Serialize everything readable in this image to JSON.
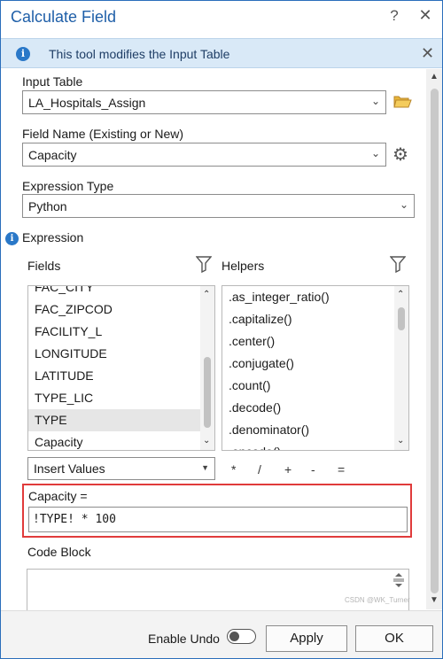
{
  "titlebar": {
    "title": "Calculate Field",
    "help": "?",
    "close": "✕"
  },
  "banner": {
    "icon": "i",
    "text": "This tool modifies the Input Table",
    "close": "✕"
  },
  "input_table": {
    "label": "Input Table",
    "value": "LA_Hospitals_Assign"
  },
  "field_name": {
    "label": "Field Name (Existing or New)",
    "value": "Capacity"
  },
  "expression_type": {
    "label": "Expression Type",
    "value": "Python"
  },
  "expression": {
    "label": "Expression",
    "icon": "i"
  },
  "fields": {
    "label": "Fields",
    "items": [
      "FAC_CITY",
      "FAC_ZIPCOD",
      "FACILITY_L",
      "LONGITUDE",
      "LATITUDE",
      "TYPE_LIC",
      "TYPE",
      "Capacity"
    ],
    "selected_index": 6
  },
  "helpers": {
    "label": "Helpers",
    "items": [
      ".as_integer_ratio()",
      ".capitalize()",
      ".center()",
      ".conjugate()",
      ".count()",
      ".decode()",
      ".denominator()",
      ".encode()"
    ]
  },
  "insert_values": {
    "label": "Insert Values"
  },
  "operators": [
    "*",
    "/",
    "+",
    "-",
    "="
  ],
  "expression_box": {
    "label": "Capacity =",
    "value": "!TYPE! * 100"
  },
  "code_block": {
    "label": "Code Block"
  },
  "footer": {
    "undo_label": "Enable Undo",
    "apply": "Apply",
    "ok": "OK"
  },
  "watermark": "CSDN @WK_Turner",
  "colors": {
    "accent": "#1f5fa8",
    "highlight": "#e03b3b",
    "banner_bg": "#d9e9f7"
  }
}
